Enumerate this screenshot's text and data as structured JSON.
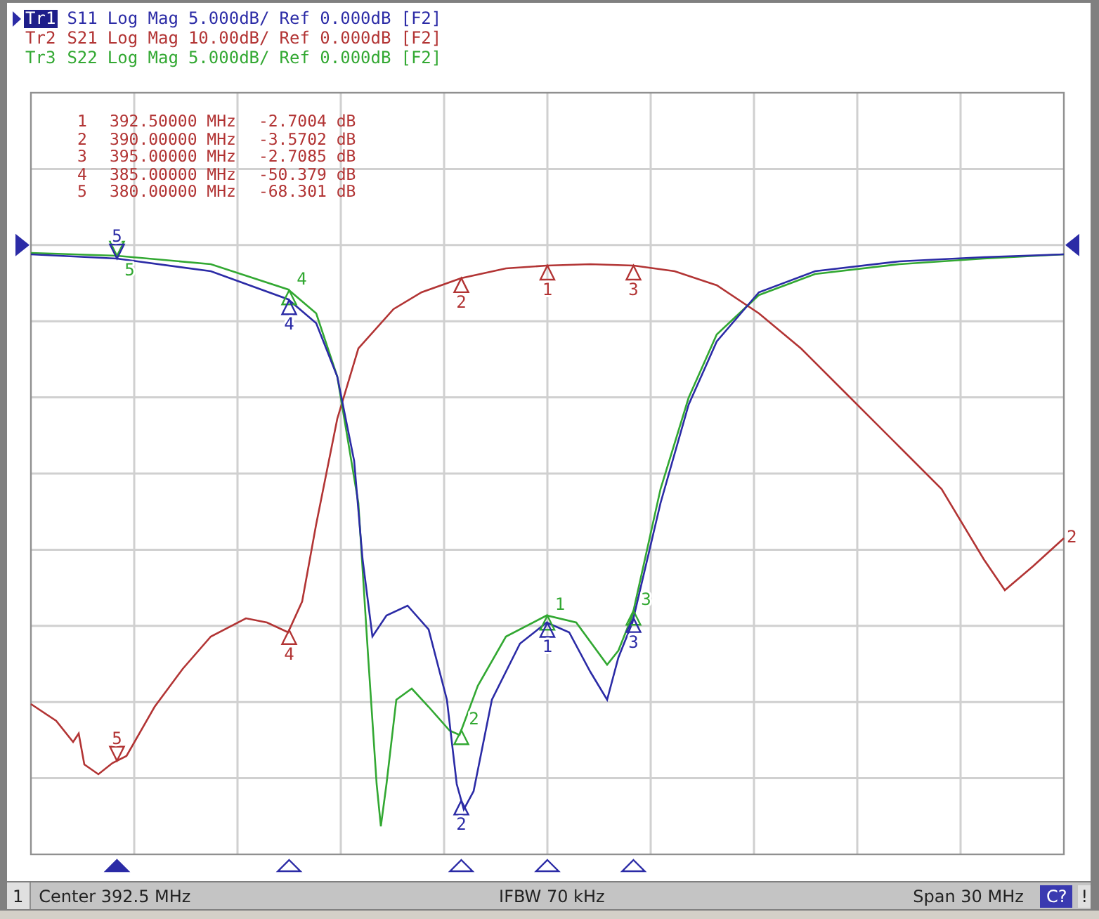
{
  "traces": [
    {
      "name": "Tr1",
      "parameter": "S11",
      "format": "Log Mag",
      "scale": "5.000dB/",
      "reference": "Ref 0.000dB",
      "tag": "[F2]",
      "color": "#2b2ba6",
      "selected": true,
      "marker_labels": [
        "1",
        "2",
        "3",
        "4",
        "5"
      ]
    },
    {
      "name": "Tr2",
      "parameter": "S21",
      "format": "Log Mag",
      "scale": "10.00dB/",
      "reference": "Ref 0.000dB",
      "tag": "[F2]",
      "color": "#b23434",
      "selected": false,
      "marker_labels": [
        "1",
        "2",
        "3",
        "4",
        "5"
      ],
      "end_label": "2"
    },
    {
      "name": "Tr3",
      "parameter": "S22",
      "format": "Log Mag",
      "scale": "5.000dB/",
      "reference": "Ref 0.000dB",
      "tag": "[F2]",
      "color": "#32a832",
      "selected": false,
      "marker_labels": [
        "1",
        "2",
        "3",
        "4",
        "5"
      ]
    }
  ],
  "marker_table": [
    {
      "index": "1",
      "frequency": "392.50000 MHz",
      "value": "-2.7004 dB"
    },
    {
      "index": "2",
      "frequency": "390.00000 MHz",
      "value": "-3.5702 dB"
    },
    {
      "index": "3",
      "frequency": "395.00000 MHz",
      "value": "-2.7085 dB"
    },
    {
      "index": "4",
      "frequency": "385.00000 MHz",
      "value": "-50.379 dB"
    },
    {
      "index": "5",
      "frequency": "380.00000 MHz",
      "value": "-68.301 dB"
    }
  ],
  "axis_markers": [
    {
      "active": false
    },
    {
      "active": false
    },
    {
      "active": false
    },
    {
      "active": false
    },
    {
      "active": true
    }
  ],
  "status_bar": {
    "channel": "1",
    "center": "Center 392.5 MHz",
    "ifbw": "IFBW 70 kHz",
    "span": "Span 30 MHz",
    "badge": "C?",
    "alert": "!"
  }
}
